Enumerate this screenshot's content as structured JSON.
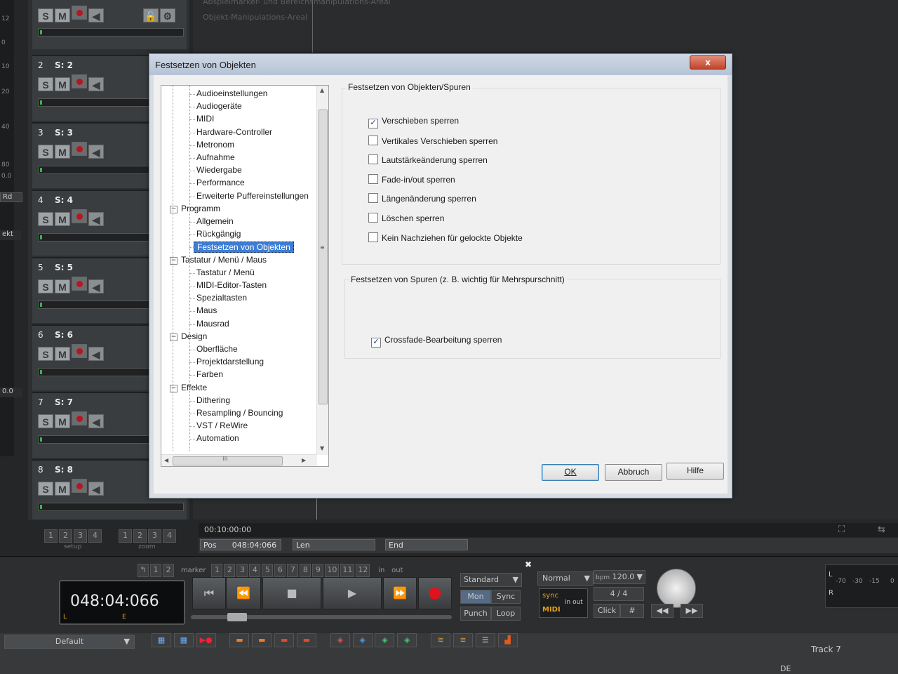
{
  "ruler": {
    "marks": [
      "12",
      "0",
      "10",
      "20",
      "40",
      "80",
      "0.0"
    ]
  },
  "left_strip": {
    "rd": "Rd",
    "ekt": "ekt",
    "val": "0.0"
  },
  "tracks": [
    {
      "num": "2",
      "name": "S: 2"
    },
    {
      "num": "3",
      "name": "S: 3"
    },
    {
      "num": "4",
      "name": "S: 4"
    },
    {
      "num": "5",
      "name": "S: 5"
    },
    {
      "num": "6",
      "name": "S: 6"
    },
    {
      "num": "7",
      "name": "S: 7"
    },
    {
      "num": "8",
      "name": "S: 8"
    }
  ],
  "track_buttons": {
    "solo": "S",
    "mute": "M"
  },
  "arrange": {
    "line1": "Abspielmarker- und Bereichsmanipulations-Areal",
    "line2": "Objekt-Manipulations-Areal"
  },
  "dialog": {
    "title": "Festsetzen von Objekten",
    "close": "x",
    "tree": [
      {
        "label": "Audioeinstellungen",
        "level": 2
      },
      {
        "label": "Audiogeräte",
        "level": 2
      },
      {
        "label": "MIDI",
        "level": 2
      },
      {
        "label": "Hardware-Controller",
        "level": 2
      },
      {
        "label": "Metronom",
        "level": 2
      },
      {
        "label": "Aufnahme",
        "level": 2
      },
      {
        "label": "Wiedergabe",
        "level": 2
      },
      {
        "label": "Performance",
        "level": 2
      },
      {
        "label": "Erweiterte Puffereinstellungen",
        "level": 2
      },
      {
        "label": "Programm",
        "level": 1
      },
      {
        "label": "Allgemein",
        "level": 2
      },
      {
        "label": "Rückgängig",
        "level": 2
      },
      {
        "label": "Festsetzen von Objekten",
        "level": 2,
        "selected": true
      },
      {
        "label": "Tastatur / Menü / Maus",
        "level": 1
      },
      {
        "label": "Tastatur / Menü",
        "level": 2
      },
      {
        "label": "MIDI-Editor-Tasten",
        "level": 2
      },
      {
        "label": "Spezialtasten",
        "level": 2
      },
      {
        "label": "Maus",
        "level": 2
      },
      {
        "label": "Mausrad",
        "level": 2
      },
      {
        "label": "Design",
        "level": 1
      },
      {
        "label": "Oberfläche",
        "level": 2
      },
      {
        "label": "Projektdarstellung",
        "level": 2
      },
      {
        "label": "Farben",
        "level": 2
      },
      {
        "label": "Effekte",
        "level": 1
      },
      {
        "label": "Dithering",
        "level": 2
      },
      {
        "label": "Resampling / Bouncing",
        "level": 2
      },
      {
        "label": "VST / ReWire",
        "level": 2
      },
      {
        "label": "Automation",
        "level": 2
      }
    ],
    "hscroll_label": "III",
    "group1": {
      "title": "Festsetzen von Objekten/Spuren",
      "options": [
        {
          "label": "Verschieben sperren",
          "checked": true
        },
        {
          "label": "Vertikales Verschieben sperren",
          "checked": false
        },
        {
          "label": "Lautstärkeänderung sperren",
          "checked": false
        },
        {
          "label": "Fade-in/out sperren",
          "checked": false
        },
        {
          "label": "Längenänderung sperren",
          "checked": false
        },
        {
          "label": "Löschen sperren",
          "checked": false
        },
        {
          "label": "Kein Nachziehen für gelockte Objekte",
          "checked": false
        }
      ]
    },
    "group2": {
      "title": "Festsetzen von Spuren (z. B. wichtig für Mehrspurschnitt)",
      "options": [
        {
          "label": "Crossfade-Bearbeitung sperren",
          "checked": true
        }
      ]
    },
    "buttons": {
      "ok": "OK",
      "cancel": "Abbruch",
      "help": "Hilfe"
    }
  },
  "bottom": {
    "setup_label": "setup",
    "zoom_label": "zoom",
    "digits": [
      "1",
      "2",
      "3",
      "4"
    ],
    "timecode": "00:10:00:00",
    "pos_label": "Pos",
    "pos_value": "048:04:066",
    "len_label": "Len",
    "end_label": "End",
    "marker_label": "marker",
    "marker_digits": [
      "1",
      "2",
      "3",
      "4",
      "5",
      "6",
      "7",
      "8",
      "9",
      "10",
      "11",
      "12"
    ],
    "in_label": "in",
    "out_label": "out",
    "lcd_time": "048:04:066",
    "lcd_l": "L",
    "lcd_e": "E",
    "mode": "Standard",
    "mon": "Mon",
    "sync": "Sync",
    "punch": "Punch",
    "loop": "Loop",
    "normal": "Normal",
    "sync_small": "sync",
    "midi_small": "MIDI",
    "inout_small": "in out",
    "bpm_label": "bpm",
    "bpm_value": "120.0",
    "sig": "4 / 4",
    "click": "Click",
    "meter_l": "L",
    "meter_r": "R",
    "meter_scale": [
      "-70",
      "-30",
      "-15",
      "0"
    ],
    "default_label": "Default",
    "track_label": "Track 7",
    "lang": "DE"
  }
}
